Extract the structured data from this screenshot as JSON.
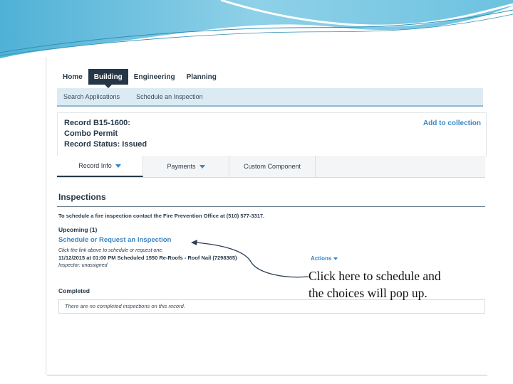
{
  "nav": {
    "items": [
      {
        "label": "Home"
      },
      {
        "label": "Building",
        "active": true
      },
      {
        "label": "Engineering"
      },
      {
        "label": "Planning"
      }
    ]
  },
  "subnav": {
    "items": [
      "Search Applications",
      "Schedule an Inspection"
    ]
  },
  "record": {
    "line1": "Record B15-1600:",
    "line2": "Combo Permit",
    "line3": "Record Status: Issued",
    "add_link": "Add to collection"
  },
  "tabs": [
    "Record Info",
    "Payments",
    "Custom Component"
  ],
  "inspections": {
    "title": "Inspections",
    "fire_note": "To schedule a fire inspection contact the Fire Prevention Office at (510) 577-3317.",
    "upcoming": "Upcoming (1)",
    "schedule_link": "Schedule or Request an Inspection",
    "hint": "Click the link above to schedule or request one.",
    "scheduled_item": "11/12/2015 at 01:00 PM Scheduled 1550 Re-Roofs - Roof Nail (7298365)",
    "inspector": "Inspector: unassigned",
    "actions": "Actions",
    "completed_title": "Completed",
    "no_completed": "There are no completed inspections on this record."
  },
  "annotation": {
    "line1": "Click here to schedule and",
    "line2": "the choices will pop up."
  },
  "colors": {
    "nav_active": "#253746",
    "link": "#3a86c4",
    "subnav_bg": "#dcebf3",
    "wave": "#5bb8d9"
  }
}
